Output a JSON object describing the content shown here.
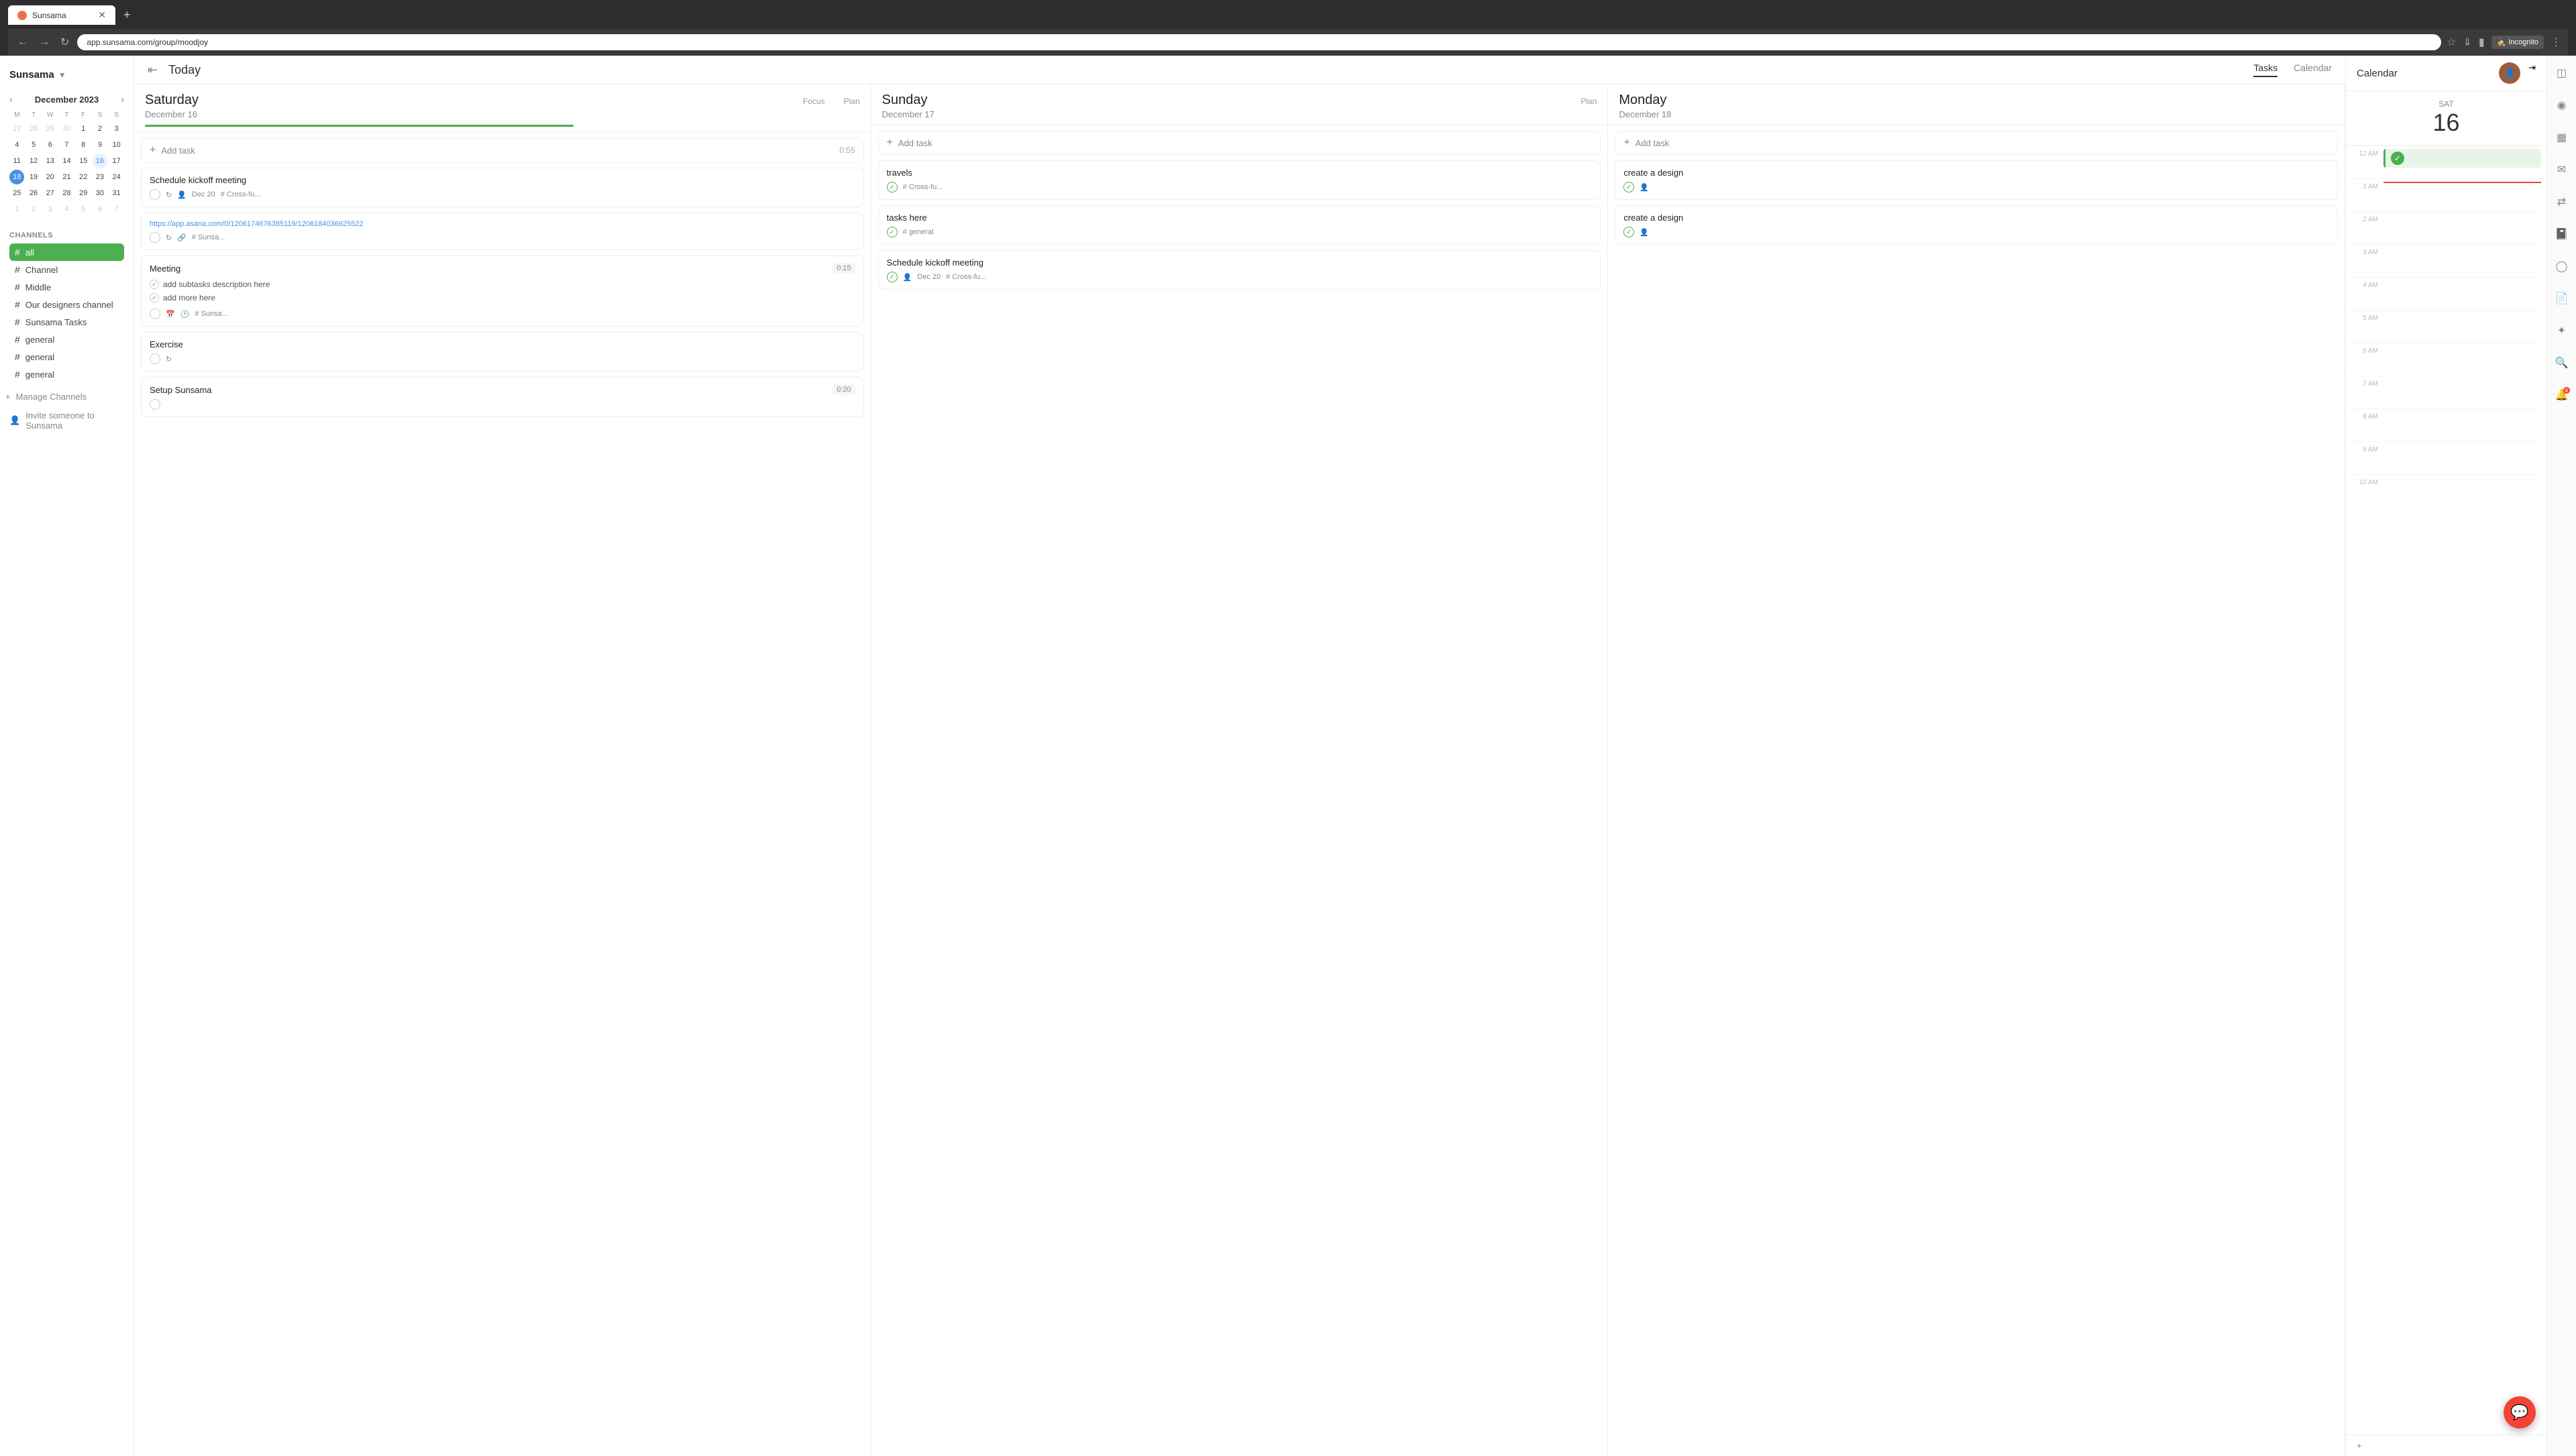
{
  "browser": {
    "tab_title": "Sunsama",
    "url": "app.sunsama.com/group/moodjoy",
    "incognito_label": "Incognito"
  },
  "sidebar": {
    "app_title": "Sunsama",
    "calendar": {
      "month_year": "December 2023",
      "day_headers": [
        "M",
        "T",
        "W",
        "T",
        "F",
        "S",
        "S"
      ],
      "weeks": [
        [
          {
            "n": "27",
            "om": true
          },
          {
            "n": "28",
            "om": true
          },
          {
            "n": "29",
            "om": true
          },
          {
            "n": "30",
            "om": true
          },
          {
            "n": "1"
          },
          {
            "n": "2"
          },
          {
            "n": "3"
          }
        ],
        [
          {
            "n": "4"
          },
          {
            "n": "5"
          },
          {
            "n": "6"
          },
          {
            "n": "7"
          },
          {
            "n": "8"
          },
          {
            "n": "9"
          },
          {
            "n": "10"
          }
        ],
        [
          {
            "n": "11"
          },
          {
            "n": "12"
          },
          {
            "n": "13"
          },
          {
            "n": "14"
          },
          {
            "n": "15"
          },
          {
            "n": "16"
          },
          {
            "n": "17"
          }
        ],
        [
          {
            "n": "18",
            "today": true
          },
          {
            "n": "19"
          },
          {
            "n": "20"
          },
          {
            "n": "21"
          },
          {
            "n": "22"
          },
          {
            "n": "23"
          },
          {
            "n": "24"
          }
        ],
        [
          {
            "n": "25"
          },
          {
            "n": "26"
          },
          {
            "n": "27"
          },
          {
            "n": "28"
          },
          {
            "n": "29"
          },
          {
            "n": "30"
          },
          {
            "n": "31"
          }
        ],
        [
          {
            "n": "1",
            "om": true
          },
          {
            "n": "2",
            "om": true
          },
          {
            "n": "3",
            "om": true
          },
          {
            "n": "4",
            "om": true
          },
          {
            "n": "5",
            "om": true
          },
          {
            "n": "6",
            "om": true
          },
          {
            "n": "7",
            "om": true
          }
        ]
      ]
    },
    "channels_label": "CHANNELS",
    "channels": [
      {
        "name": "all",
        "active": true
      },
      {
        "name": "Channel"
      },
      {
        "name": "Middle"
      },
      {
        "name": "Our designers channel"
      },
      {
        "name": "Sunsama Tasks"
      },
      {
        "name": "general"
      },
      {
        "name": "general"
      },
      {
        "name": "general"
      }
    ],
    "manage_channels": "Manage Channels",
    "invite_label": "Invite someone to Sunsama"
  },
  "header": {
    "today_label": "Today",
    "tabs": [
      {
        "label": "Tasks",
        "active": true
      },
      {
        "label": "Calendar"
      }
    ],
    "right_panel_title": "Calendar",
    "panel_day_label": "SAT",
    "panel_day_num": "16"
  },
  "days": [
    {
      "name": "Saturday",
      "date": "December 16",
      "actions": [
        "Focus",
        "Plan"
      ],
      "has_progress": true,
      "tasks": [
        {
          "type": "add",
          "label": "Add task",
          "time": "0:55"
        },
        {
          "type": "task",
          "title": "Schedule kickoff meeting",
          "check_done": false,
          "date": "Dec 20",
          "tag": "Cross-fu...",
          "has_repeat": true,
          "has_avatar": true
        },
        {
          "type": "task",
          "title": "https://app.asana.com/0/1206174676385119/1206184036625522",
          "is_url": true,
          "check_done": false,
          "tag": "Sunsa...",
          "has_link": true,
          "has_repeat": true
        },
        {
          "type": "task",
          "title": "Meeting",
          "time": "0:15",
          "subtasks": [
            "add subtasks description here",
            "add more here"
          ],
          "tag": "Sunsa...",
          "has_calendar": true,
          "has_clock": true
        },
        {
          "type": "task",
          "title": "Exercise",
          "check_done": false,
          "has_repeat": true
        },
        {
          "type": "task",
          "title": "Setup Sunsama",
          "time": "0:20"
        }
      ]
    },
    {
      "name": "Sunday",
      "date": "December 17",
      "actions": [
        "Plan"
      ],
      "tasks": [
        {
          "type": "add",
          "label": "Add task"
        },
        {
          "type": "task",
          "title": "travels",
          "check_done": true,
          "tag": "Cross-fu..."
        },
        {
          "type": "task",
          "title": "tasks here",
          "check_done": true,
          "tag": "general"
        },
        {
          "type": "task",
          "title": "Schedule kickoff meeting",
          "check_done": true,
          "date": "Dec 20",
          "tag": "Cross-fu...",
          "has_avatar": true
        }
      ]
    },
    {
      "name": "Monday",
      "date": "December 18",
      "tasks": [
        {
          "type": "add",
          "label": "Add task"
        },
        {
          "type": "task",
          "title": "create a design",
          "check_done": true,
          "has_avatar": true
        },
        {
          "type": "task",
          "title": "create a design",
          "check_done": true,
          "has_avatar": true
        }
      ]
    }
  ],
  "right_calendar": {
    "title": "Calendar",
    "day_label": "SAT",
    "day_num": "16",
    "times": [
      "12 AM",
      "1 AM",
      "2 AM",
      "3 AM",
      "4 AM",
      "5 AM",
      "6 AM",
      "7 AM",
      "8 AM",
      "9 AM",
      "10 AM"
    ]
  }
}
